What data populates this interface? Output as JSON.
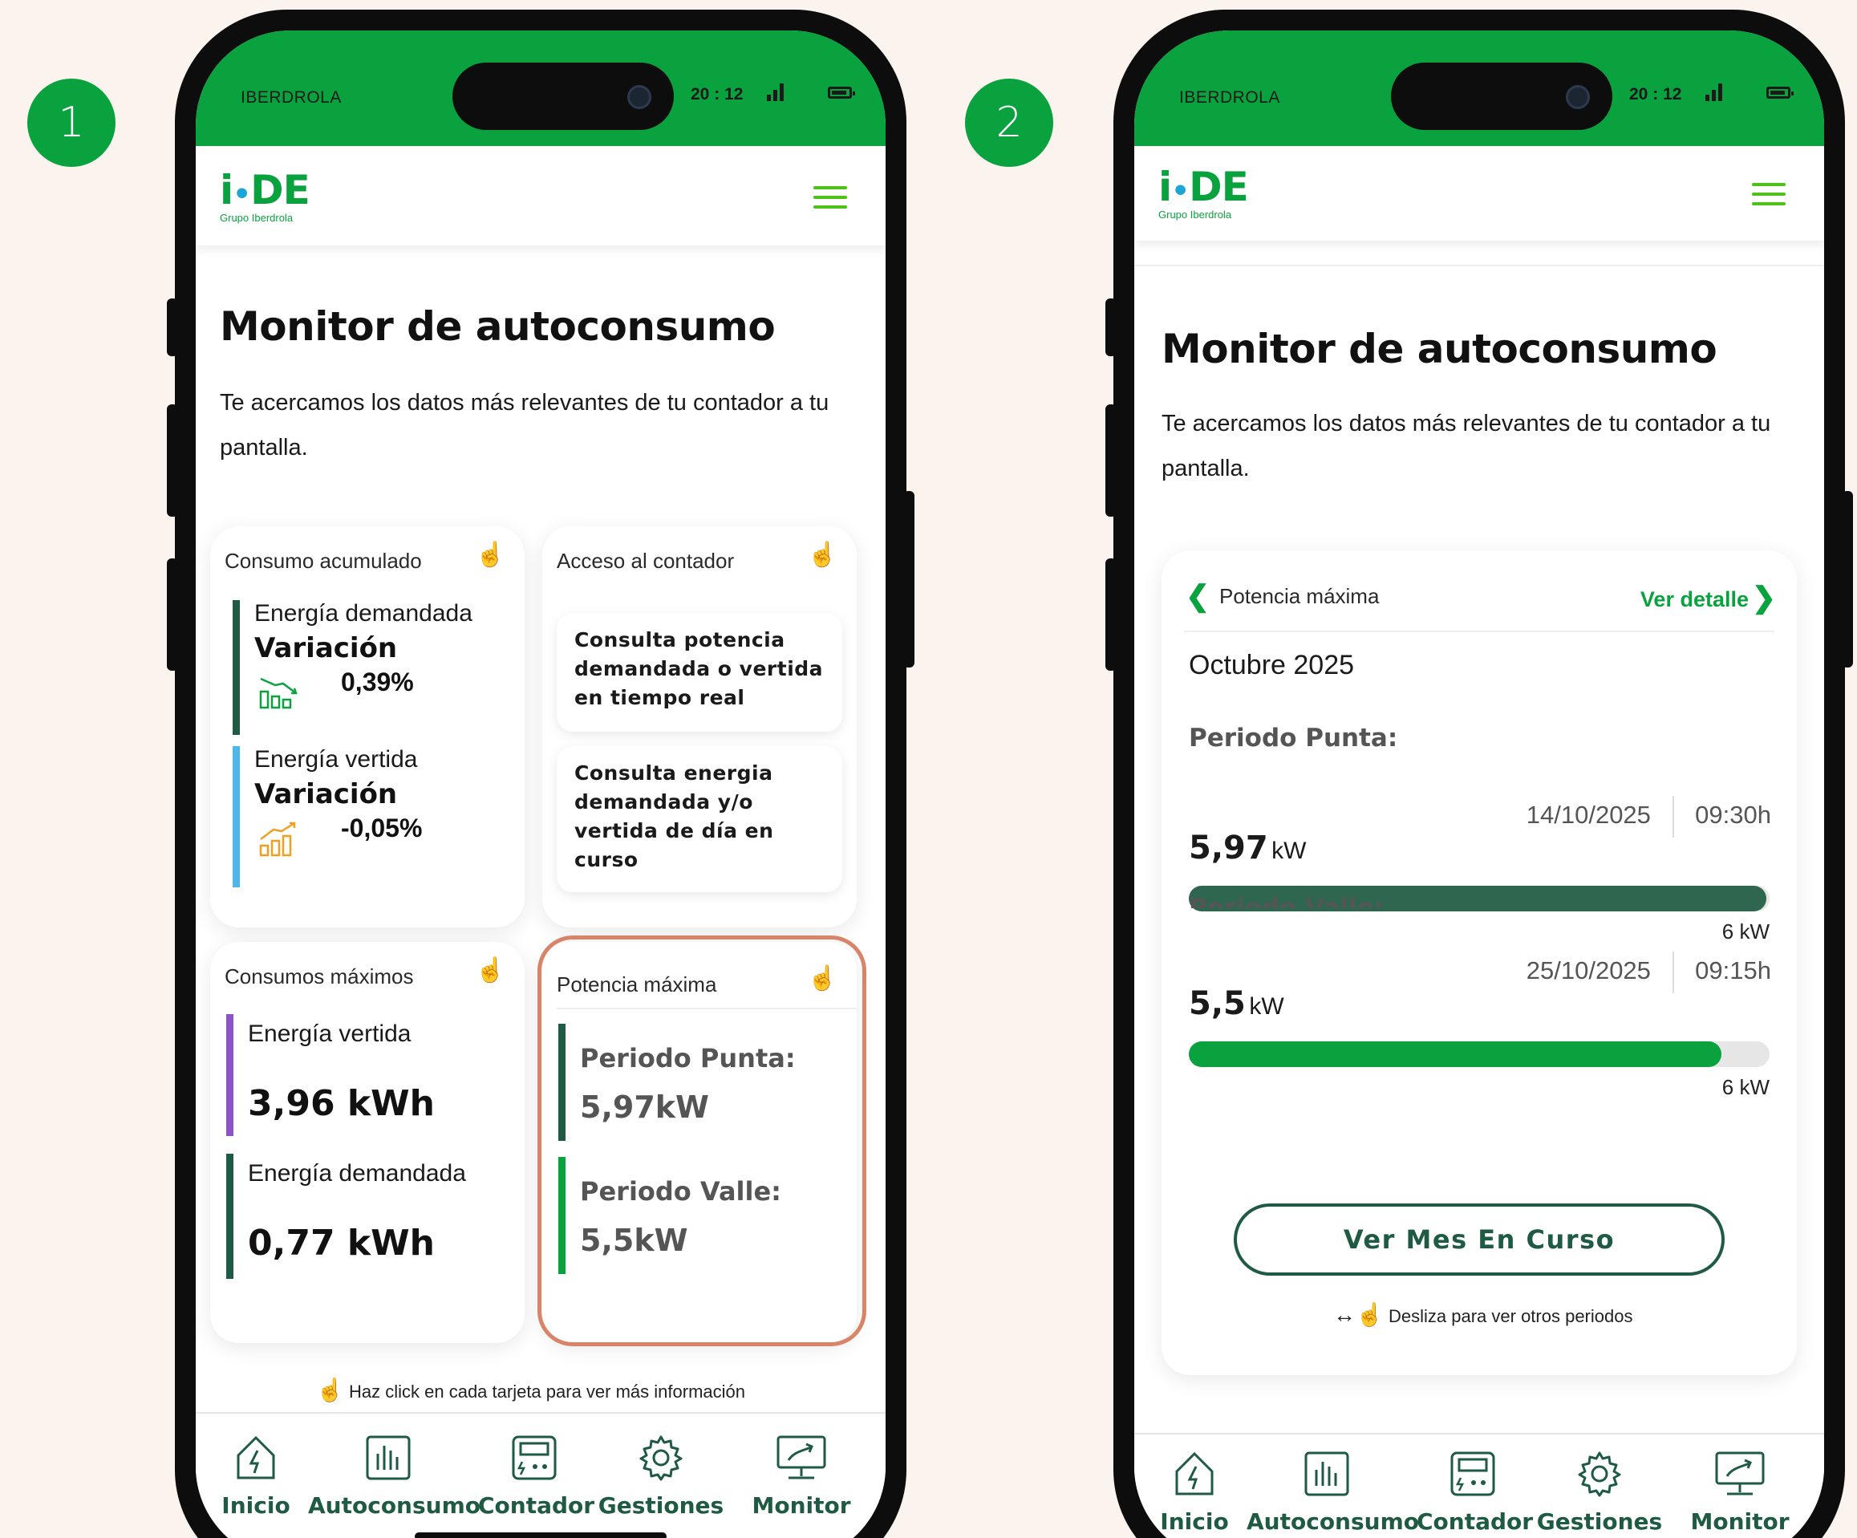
{
  "badges": [
    "1",
    "2"
  ],
  "status_bar": {
    "carrier": "IBERDROLA",
    "time": "20 : 12"
  },
  "brand": {
    "logo_text": "i-DE",
    "logo_sub": "Grupo Iberdrola"
  },
  "page": {
    "title": "Monitor de autoconsumo",
    "intro": "Te acercamos los datos más relevantes de tu contador a tu pantalla."
  },
  "screen1": {
    "consumo_acumulado": {
      "title": "Consumo acumulado",
      "demandada_label": "Energía demandada",
      "demandada_var_label": "Variación",
      "demandada_var": "0,39%",
      "vertida_label": "Energía vertida",
      "vertida_var_label": "Variación",
      "vertida_var": "-0,05%"
    },
    "acceso_contador": {
      "title": "Acceso al contador",
      "btn1": "Consulta potencia demandada o vertida en tiempo real",
      "btn2": "Consulta energia demandada y/o vertida de día en curso"
    },
    "consumos_maximos": {
      "title": "Consumos máximos",
      "vertida_label": "Energía vertida",
      "vertida_value": "3,96 kWh",
      "demandada_label": "Energía demandada",
      "demandada_value": "0,77 kWh"
    },
    "potencia_maxima": {
      "title": "Potencia máxima",
      "punta_label": "Periodo Punta:",
      "punta_value": "5,97kW",
      "valle_label": "Periodo Valle:",
      "valle_value": "5,5kW"
    },
    "hint": "Haz click en cada tarjeta para ver más información"
  },
  "screen2": {
    "card_title": "Potencia máxima",
    "detail_link": "Ver detalle",
    "month": "Octubre 2025",
    "punta": {
      "label": "Periodo Punta:",
      "date": "14/10/2025",
      "time": "09:30h",
      "value": "5,97",
      "unit": "kW",
      "max_label": "6 kW",
      "fill_fraction": 0.995
    },
    "valle": {
      "label": "Periodo Valle:",
      "date": "25/10/2025",
      "time": "09:15h",
      "value": "5,5",
      "unit": "kW",
      "max_label": "6 kW",
      "fill_fraction": 0.9167
    },
    "cta_button": "Ver Mes En Curso",
    "swipe_hint": "Desliza para ver otros periodos"
  },
  "tabs": [
    "Inicio",
    "Autoconsumo",
    "Contador",
    "Gestiones",
    "Monitor"
  ],
  "colors": {
    "brand_green": "#0aa23e",
    "dark_green": "#1f5a44",
    "light_blue": "#4fb6ea",
    "purple": "#8e52c9",
    "highlight_border": "#d98468",
    "orange_icon": "#f0a020"
  }
}
